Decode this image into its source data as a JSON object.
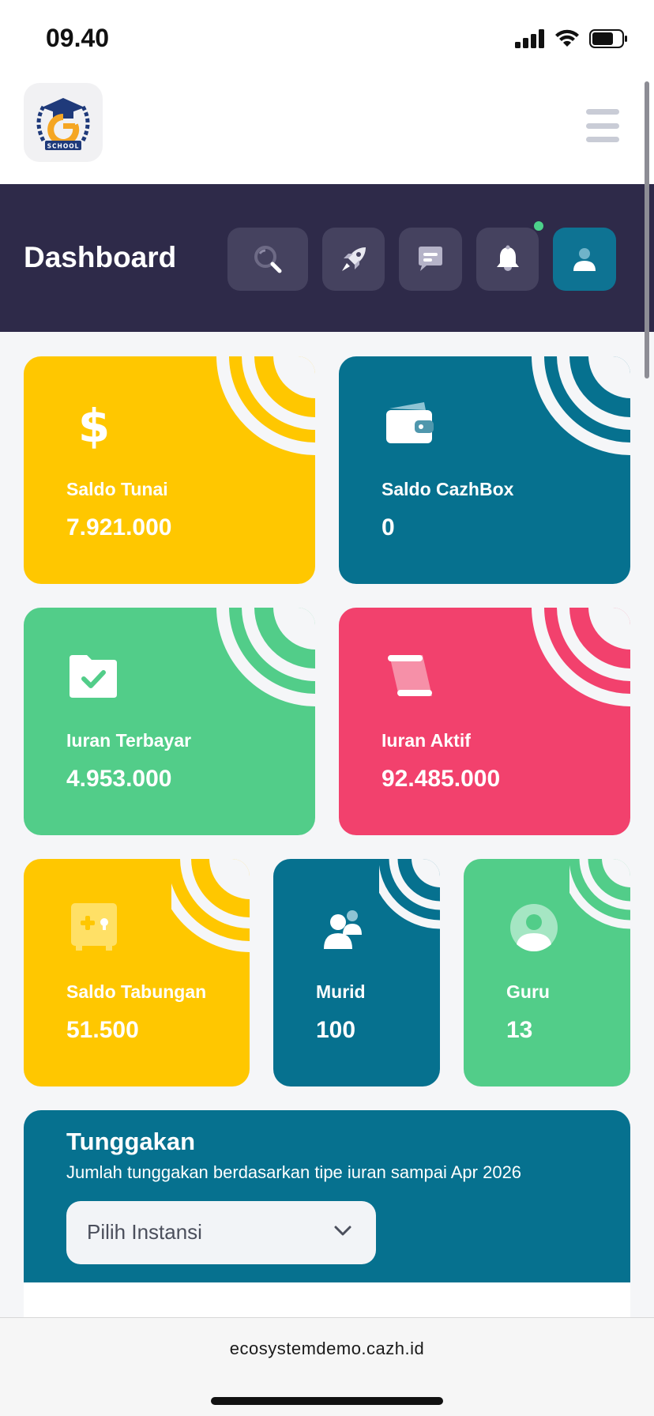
{
  "status_bar": {
    "time": "09.40"
  },
  "header": {
    "logo_text": "SCHOOL"
  },
  "banner": {
    "title": "Dashboard"
  },
  "cards": [
    {
      "label": "Saldo Tunai",
      "value": "7.921.000",
      "icon": "dollar-icon",
      "color": "#ffc700"
    },
    {
      "label": "Saldo CazhBox",
      "value": "0",
      "icon": "wallet-icon",
      "color": "#06718f"
    },
    {
      "label": "Iuran Terbayar",
      "value": "4.953.000",
      "icon": "folder-check-icon",
      "color": "#52cd89"
    },
    {
      "label": "Iuran Aktif",
      "value": "92.485.000",
      "icon": "scroll-icon",
      "color": "#f2416d"
    },
    {
      "label": "Saldo Tabungan",
      "value": "51.500",
      "icon": "safe-icon",
      "color": "#ffc700"
    },
    {
      "label": "Murid",
      "value": "100",
      "icon": "students-icon",
      "color": "#06718f"
    },
    {
      "label": "Guru",
      "value": "13",
      "icon": "teacher-icon",
      "color": "#52cd89"
    }
  ],
  "tunggakan": {
    "title": "Tunggakan",
    "subtitle": "Jumlah tunggakan berdasarkan tipe iuran sampai Apr 2026",
    "select_value": "Pilih Instansi"
  },
  "browser": {
    "url": "ecosystemdemo.cazh.id"
  }
}
